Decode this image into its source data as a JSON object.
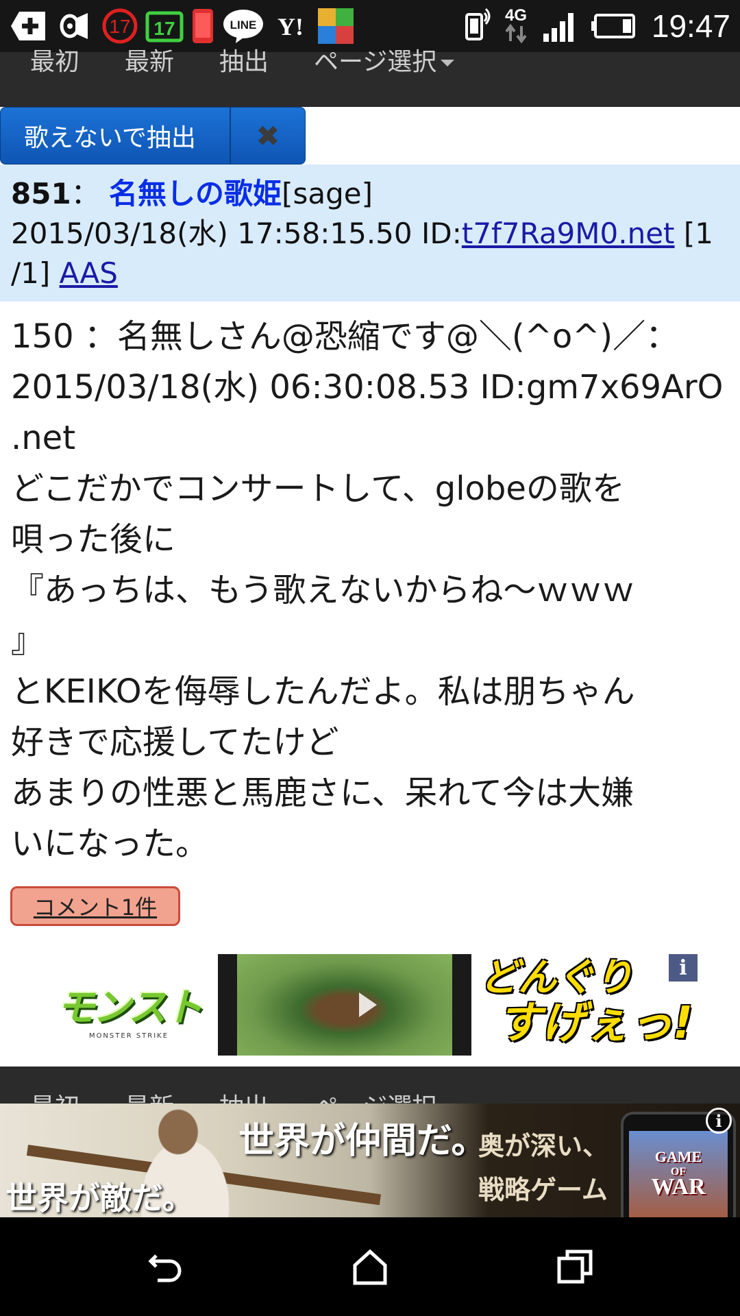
{
  "status_bar": {
    "time": "19:47",
    "network": "4G",
    "badge_1": "17",
    "badge_2": "17",
    "line_label": "LINE",
    "yahoo_label": "Y!",
    "icons": [
      "add-icon",
      "speaker-icon",
      "badge-17-icon",
      "calendar-17-icon",
      "phone-icon",
      "line-icon",
      "yahoo-icon",
      "app-icon",
      "vibrate-icon",
      "network-4g-icon",
      "signal-icon",
      "battery-icon"
    ]
  },
  "nav": {
    "first": "最初",
    "latest": "最新",
    "extract": "抽出",
    "page_select": "ページ選択"
  },
  "filter": {
    "label": "歌えないで抽出",
    "close_symbol": "✖"
  },
  "post": {
    "number": "851",
    "separator": "：",
    "name": "名無しの歌姫",
    "mail": "[sage]",
    "date": "2015/03/18(水) 17:58:15.50 ID:",
    "id": "t7f7Ra9M0.net",
    "count_part1": " [1",
    "count_part2": "/1]",
    "aas": "AAS",
    "body_lines": [
      "150 ：名無しさん@恐縮です@＼(^o^)／：",
      "2015/03/18(水) 06:30:08.53 ID:gm7x69ArO",
      ".net",
      "どこだかでコンサートして、globeの歌を",
      "唄った後に",
      "『あっちは、もう歌えないからね～ｗｗｗ",
      "』",
      "とKEIKOを侮辱したんだよ。私は朋ちゃん",
      "好きで応援してたけど",
      "あまりの性悪と馬鹿さに、呆れて今は大嫌",
      "いになった。"
    ],
    "comment_button": "コメント1件"
  },
  "ad1": {
    "logo_text": "モンスト",
    "logo_sub": "MONSTER STRIKE",
    "slogan_line1": "どんぐり",
    "slogan_line2": "すげぇっ!",
    "info": "i"
  },
  "ad2": {
    "text_top": "世界が仲間だ。",
    "text_bottom": "世界が敵だ。",
    "text_right_1": "奥が深い、",
    "text_right_2": "戦略ゲーム",
    "game_line1": "GAME",
    "game_line2": "OF",
    "game_line3": "WAR",
    "info": "i"
  },
  "colors": {
    "status_bar": "#161616",
    "navbar": "#2b2b2b",
    "filter_chip": "#1565c8",
    "post_header": "#d8ebfb",
    "name_link": "#0a2ee6",
    "comment_button": "#f2a38f",
    "comment_border": "#c94b3b"
  }
}
